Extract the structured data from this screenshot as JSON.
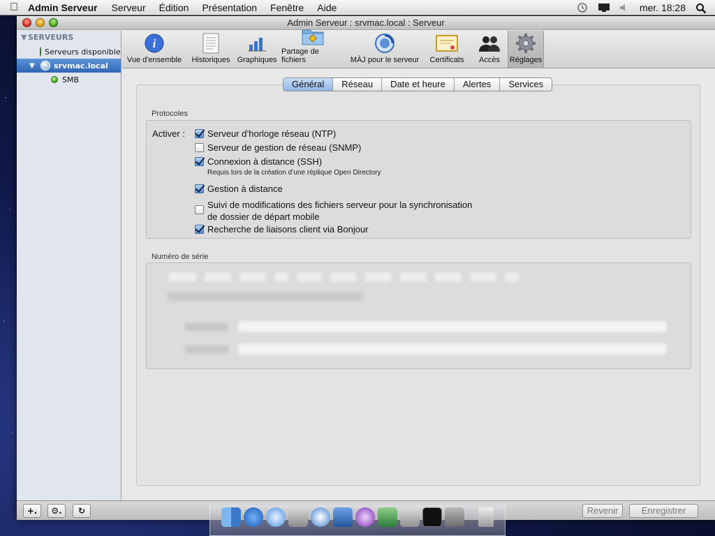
{
  "menubar": {
    "app_name": "Admin Serveur",
    "menus": [
      "Serveur",
      "Édition",
      "Présentation",
      "Fenêtre",
      "Aide"
    ],
    "clock": "mer. 18:28"
  },
  "window": {
    "title": "Admin Serveur : srvmac.local : Serveur"
  },
  "sidebar": {
    "section_title": "SERVEURS",
    "items": [
      {
        "label": "Serveurs disponibles"
      },
      {
        "label": "srvmac.local"
      },
      {
        "label": "SMB"
      }
    ]
  },
  "toolbar": {
    "items": [
      {
        "label": "Vue d'ensemble",
        "icon": "info-icon"
      },
      {
        "label": "Historiques",
        "icon": "log-icon"
      },
      {
        "label": "Graphiques",
        "icon": "bar-chart-icon"
      },
      {
        "label": "Partage de fichiers",
        "icon": "shared-folder-icon"
      },
      {
        "label": "MÀJ pour le serveur",
        "icon": "software-update-icon"
      },
      {
        "label": "Certificats",
        "icon": "certificate-icon"
      },
      {
        "label": "Accès",
        "icon": "users-icon"
      },
      {
        "label": "Réglages",
        "icon": "gear-icon"
      }
    ],
    "active": "Réglages"
  },
  "tabs": {
    "items": [
      "Général",
      "Réseau",
      "Date et heure",
      "Alertes",
      "Services"
    ],
    "active": "Général"
  },
  "protocoles": {
    "title": "Protocoles",
    "activer_label": "Activer :",
    "items": [
      {
        "label": "Serveur d’horloge réseau (NTP)",
        "checked": true
      },
      {
        "label": "Serveur de gestion de réseau (SNMP)",
        "checked": false
      },
      {
        "label": "Connexion à distance (SSH)",
        "checked": true,
        "note": "Requis lors de la création d’une réplique Open Directory"
      },
      {
        "label": "Gestion à distance",
        "checked": true
      },
      {
        "label": "Suivi de modifications des fichiers serveur pour la synchronisation",
        "label2": "de dossier de départ mobile",
        "checked": false
      },
      {
        "label": "Recherche de liaisons client via Bonjour",
        "checked": true
      }
    ]
  },
  "serial": {
    "title": "Numéro de série"
  },
  "buttons": {
    "revert": "Revenir",
    "save": "Enregistrer",
    "add": "+.",
    "action": "⚙.",
    "refresh": "↻"
  }
}
